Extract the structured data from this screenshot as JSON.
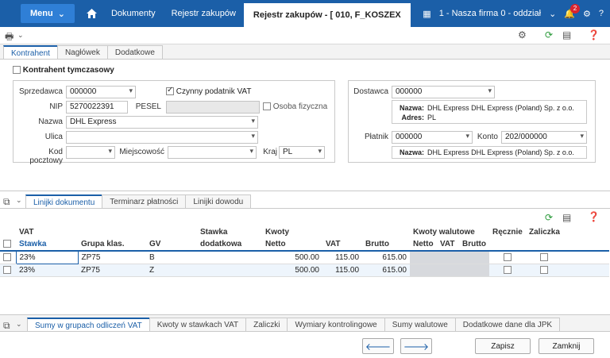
{
  "titlebar": {
    "menu_label": "Menu",
    "tabs": [
      {
        "label": "Dokumenty"
      },
      {
        "label": "Rejestr zakupów"
      },
      {
        "label": "Rejestr zakupów - [ 010, F_KOSZEX"
      }
    ],
    "company": "1 - Nasza firma 0 - oddział",
    "notifications": "2"
  },
  "tabs_top": [
    "Kontrahent",
    "Nagłówek",
    "Dodatkowe"
  ],
  "kontrahent": {
    "temp_label": "Kontrahent tymczasowy",
    "sprzedawca_label": "Sprzedawca",
    "sprzedawca_value": "000000",
    "vat_payer_label": "Czynny podatnik VAT",
    "nip_label": "NIP",
    "nip_value": "5270022391",
    "pesel_label": "PESEL",
    "osoba_label": "Osoba fizyczna",
    "nazwa_label": "Nazwa",
    "nazwa_value": "DHL Express",
    "ulica_label": "Ulica",
    "kod_label": "Kod pocztowy",
    "miejscowosc_label": "Miejscowość",
    "kraj_label": "Kraj",
    "kraj_value": "PL"
  },
  "dostawca": {
    "label": "Dostawca",
    "value": "000000",
    "nazwa_label": "Nazwa:",
    "nazwa_value": "DHL Express DHL Express (Poland) Sp. z o.o.",
    "adres_label": "Adres:",
    "adres_value": "PL",
    "platnik_label": "Płatnik",
    "platnik_value": "000000",
    "konto_label": "Konto",
    "konto_value": "202/000000",
    "nazwa2_label": "Nazwa:",
    "nazwa2_value": "DHL Express DHL Express (Poland) Sp. z o.o."
  },
  "tabs_lines": [
    "Linijki dokumentu",
    "Terminarz płatności",
    "Linijki dowodu"
  ],
  "grid": {
    "group_vat": "VAT",
    "group_stawka_dod": "Stawka",
    "group_kwoty": "Kwoty",
    "group_kwoty_wal": "Kwoty walutowe",
    "group_recznie": "Ręcznie",
    "group_zaliczka": "Zaliczka",
    "col_stawka": "Stawka",
    "col_grupa": "Grupa klas.",
    "col_gv": "GV",
    "col_dodatkowa": "dodatkowa",
    "col_netto": "Netto",
    "col_vat": "VAT",
    "col_brutto": "Brutto",
    "col_wnetto": "Netto",
    "col_wvat": "VAT",
    "col_wbrutto": "Brutto",
    "rows": [
      {
        "stawka": "23%",
        "grupa": "ZP75",
        "gv": "B",
        "netto": "500.00",
        "vat": "115.00",
        "brutto": "615.00"
      },
      {
        "stawka": "23%",
        "grupa": "ZP75",
        "gv": "Z",
        "netto": "500.00",
        "vat": "115.00",
        "brutto": "615.00"
      }
    ]
  },
  "tabs_bottom": [
    "Sumy w grupach odliczeń VAT",
    "Kwoty w stawkach VAT",
    "Zaliczki",
    "Wymiary kontrolingowe",
    "Sumy walutowe",
    "Dodatkowe dane dla JPK"
  ],
  "buttons": {
    "save": "Zapisz",
    "close": "Zamknij"
  }
}
